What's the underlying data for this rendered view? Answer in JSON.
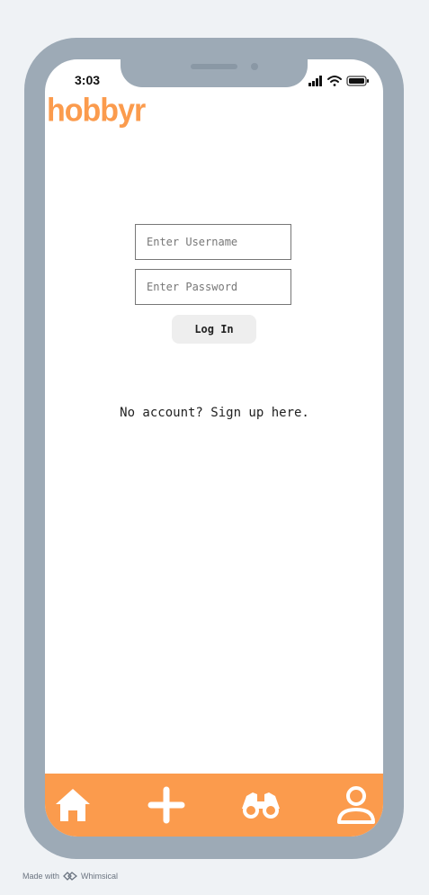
{
  "status_bar": {
    "time": "3:03"
  },
  "app": {
    "logo_text": "hobbyr",
    "brand_color": "#fb9b4d"
  },
  "login": {
    "username_placeholder": "Enter Username",
    "password_placeholder": "Enter Password",
    "login_label": "Log In",
    "signup_text": "No account? Sign up here."
  },
  "nav": {
    "items": [
      {
        "icon": "home-icon"
      },
      {
        "icon": "plus-icon"
      },
      {
        "icon": "binoculars-icon"
      },
      {
        "icon": "profile-icon"
      }
    ]
  },
  "footer": {
    "made_with": "Made with",
    "brand": "Whimsical"
  }
}
